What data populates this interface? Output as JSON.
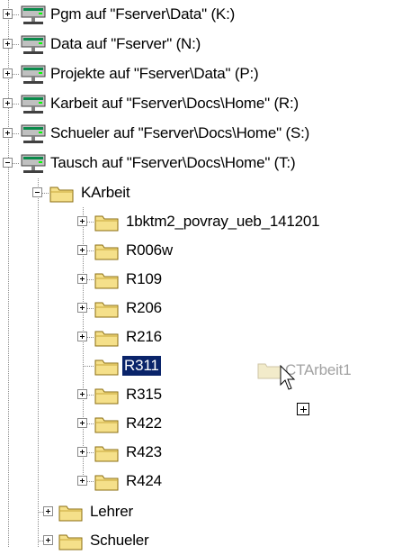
{
  "tree": {
    "drives": [
      {
        "label": "Pgm auf \"Fserver\\Data\" (K:)",
        "expanded": false
      },
      {
        "label": "Data auf \"Fserver\" (N:)",
        "expanded": false
      },
      {
        "label": "Projekte auf \"Fserver\\Data\" (P:)",
        "expanded": false
      },
      {
        "label": "Karbeit auf \"Fserver\\Docs\\Home\" (R:)",
        "expanded": false
      },
      {
        "label": "Schueler auf \"Fserver\\Docs\\Home\" (S:)",
        "expanded": false
      },
      {
        "label": "Tausch auf \"Fserver\\Docs\\Home\" (T:)",
        "expanded": true
      }
    ],
    "karbeit": {
      "label": "KArbeit",
      "expanded": true
    },
    "subfolders": [
      {
        "label": "1bktm2_povray_ueb_141201",
        "has_children": true,
        "selected": false
      },
      {
        "label": "R006w",
        "has_children": true,
        "selected": false
      },
      {
        "label": "R109",
        "has_children": true,
        "selected": false
      },
      {
        "label": "R206",
        "has_children": true,
        "selected": false
      },
      {
        "label": "R216",
        "has_children": true,
        "selected": false
      },
      {
        "label": "R311",
        "has_children": false,
        "selected": true
      },
      {
        "label": "R315",
        "has_children": true,
        "selected": false
      },
      {
        "label": "R422",
        "has_children": true,
        "selected": false
      },
      {
        "label": "R423",
        "has_children": true,
        "selected": false
      },
      {
        "label": "R424",
        "has_children": true,
        "selected": false
      }
    ],
    "siblings": [
      {
        "label": "Lehrer",
        "has_children": true
      },
      {
        "label": "Schueler",
        "has_children": true
      }
    ]
  },
  "drag": {
    "ghost_label": "CTArbeit1",
    "cursor_icon": "arrow-cursor-icon",
    "copy_badge_icon": "plus-copy-icon"
  },
  "colors": {
    "selection": "#0a246a",
    "folder_fill": "#f5e08a",
    "folder_stroke": "#8a6d10"
  }
}
